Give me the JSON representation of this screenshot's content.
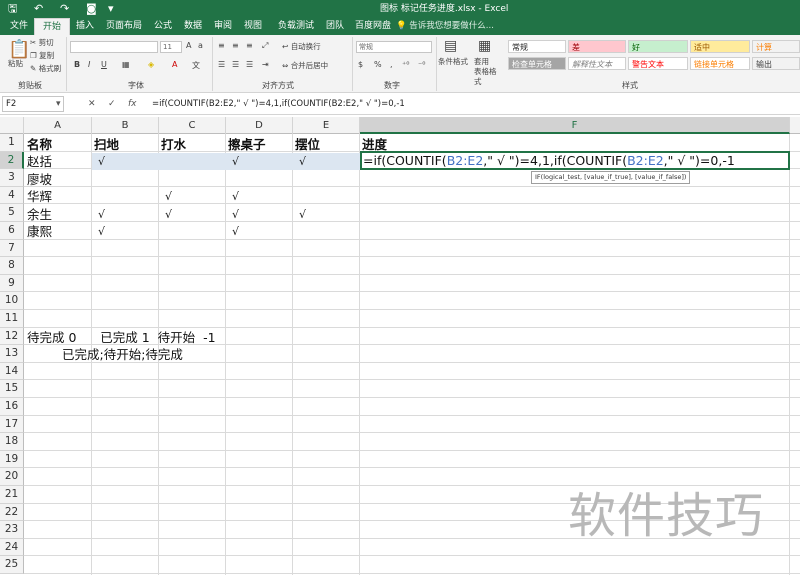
{
  "titlebar": {
    "title": "图标 标记任务进度.xlsx - Excel",
    "save_icon": "save-icon",
    "undo_icon": "undo-icon",
    "redo_icon": "redo-icon",
    "camera_icon": "camera-icon"
  },
  "tabs": [
    "文件",
    "开始",
    "插入",
    "页面布局",
    "公式",
    "数据",
    "审阅",
    "视图",
    "负载测试",
    "团队",
    "百度网盘"
  ],
  "active_tab": "开始",
  "tell_me": "告诉我您想要做什么...",
  "ribbon": {
    "clipboard": {
      "paste": "粘贴",
      "cut": "剪切",
      "copy": "复制",
      "format_painter": "格式刷",
      "label": "剪贴板"
    },
    "font": {
      "size": "11",
      "bold": "B",
      "italic": "I",
      "underline": "U",
      "label": "字体"
    },
    "alignment": {
      "wrap": "自动换行",
      "merge": "合并后居中",
      "label": "对齐方式"
    },
    "number": {
      "format": "常规",
      "label": "数字"
    },
    "styles": {
      "conditional": "条件格式",
      "table_format": "套用\n表格格式",
      "cells": [
        "常规",
        "差",
        "好",
        "适中",
        "计算",
        "检查单元格",
        "解释性文本",
        "警告文本",
        "链接单元格",
        "输出"
      ],
      "label": "样式"
    }
  },
  "formula_bar": {
    "name_box": "F2",
    "cancel": "✕",
    "enter": "✓",
    "fx": "fx",
    "formula": "=if(COUNTIF(B2:E2,\" √ \")=4,1,if(COUNTIF(B2:E2,\" √ \")=0,-1"
  },
  "columns": [
    "A",
    "B",
    "C",
    "D",
    "E",
    "F"
  ],
  "rows": [
    "1",
    "2",
    "3",
    "4",
    "5",
    "6",
    "7",
    "8",
    "9",
    "10",
    "11",
    "12",
    "13",
    "14",
    "15",
    "16",
    "17",
    "18",
    "19",
    "20",
    "21",
    "22",
    "23",
    "24",
    "25"
  ],
  "table": {
    "headers": [
      "名称",
      "扫地",
      "打水",
      "擦桌子",
      "摆位",
      "进度"
    ],
    "data": [
      {
        "name": "赵括",
        "b": "√",
        "c": "",
        "d": "√",
        "e": "√"
      },
      {
        "name": "廖坡",
        "b": "",
        "c": "",
        "d": "",
        "e": ""
      },
      {
        "name": "华辉",
        "b": "",
        "c": "√",
        "d": "√",
        "e": ""
      },
      {
        "name": "余生",
        "b": "√",
        "c": "√",
        "d": "√",
        "e": "√"
      },
      {
        "name": "康熙",
        "b": "√",
        "c": "",
        "d": "√",
        "e": ""
      }
    ]
  },
  "f2_edit": {
    "prefix": "=if(COUNTIF(",
    "ref1": "B2:E2",
    "mid1": ",\" √ \")=4,1,if(COUNTIF(",
    "ref2": "B2:E2",
    "mid2": ",\" √ \")=0,-1"
  },
  "tooltip": "IF(logical_test, [value_if_true], [value_if_false])",
  "row12": "待完成 0      已完成 1  待开始  -1",
  "row13": "已完成;待开始;待完成",
  "watermark": "软件技巧"
}
